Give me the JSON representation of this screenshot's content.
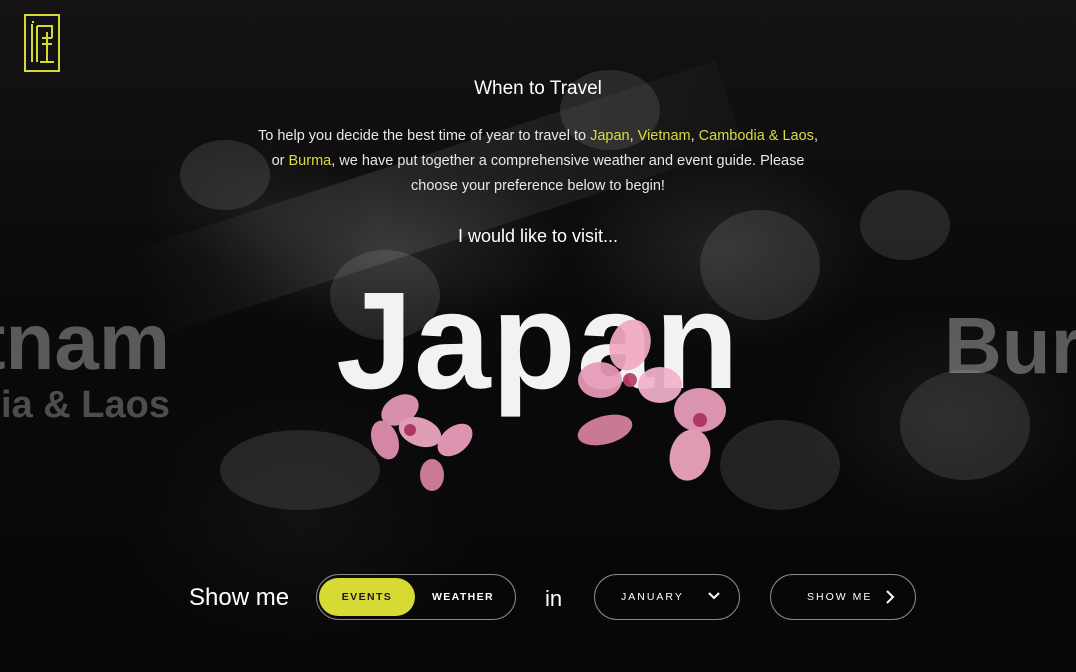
{
  "brand": {
    "logo_icon": "ia-monogram-logo",
    "accent": "#d7d935"
  },
  "header": {
    "title": "When to Travel"
  },
  "intro": {
    "part1": "To help you decide the best time of year to travel to ",
    "japan": "Japan",
    "sep1": ", ",
    "vietnam": "Vietnam",
    "sep2": ", ",
    "cambodia": "Cambodia & Laos",
    "sep3": ", or ",
    "burma": "Burma",
    "part2": ", we have put together a comprehensive weather and event guide. Please choose your preference below to begin!"
  },
  "visit_prompt": "I would like to visit...",
  "carousel": {
    "current": "Japan",
    "prev_main": "Vietnam",
    "prev_sub": "Cambodia & Laos",
    "next": "Burma"
  },
  "controls": {
    "show_label": "Show me",
    "toggle_options": [
      "EVENTS",
      "WEATHER"
    ],
    "selected_option": "EVENTS",
    "in_label": "in",
    "month_value": "JANUARY",
    "submit_label": "SHOW ME"
  }
}
